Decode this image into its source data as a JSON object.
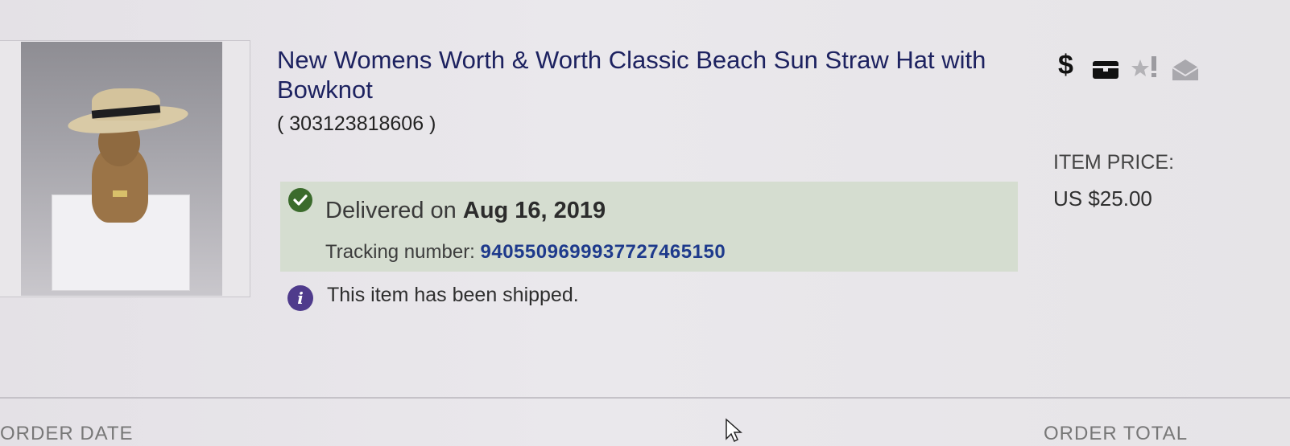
{
  "item": {
    "title": "New Womens Worth & Worth Classic Beach Sun Straw Hat with Bowknot",
    "number": "( 303123818606 )",
    "image_alt": "straw hat on mannequin head"
  },
  "status": {
    "delivered_prefix": "Delivered on ",
    "delivered_date": "Aug 16, 2019",
    "tracking_label": "Tracking number: ",
    "tracking_number": "9405509699937727465150",
    "shipped_text": "This item has been shipped.",
    "panel_color": "#d5ddd0"
  },
  "actions": {
    "icons": [
      "dollar-icon",
      "parcel-icon",
      "star-feedback-icon",
      "mail-icon"
    ],
    "dollar_glyph": "$"
  },
  "price": {
    "label": "ITEM PRICE:",
    "value": "US $25.00"
  },
  "footer": {
    "order_date_label": "ORDER DATE",
    "order_total_label": "ORDER TOTAL"
  }
}
